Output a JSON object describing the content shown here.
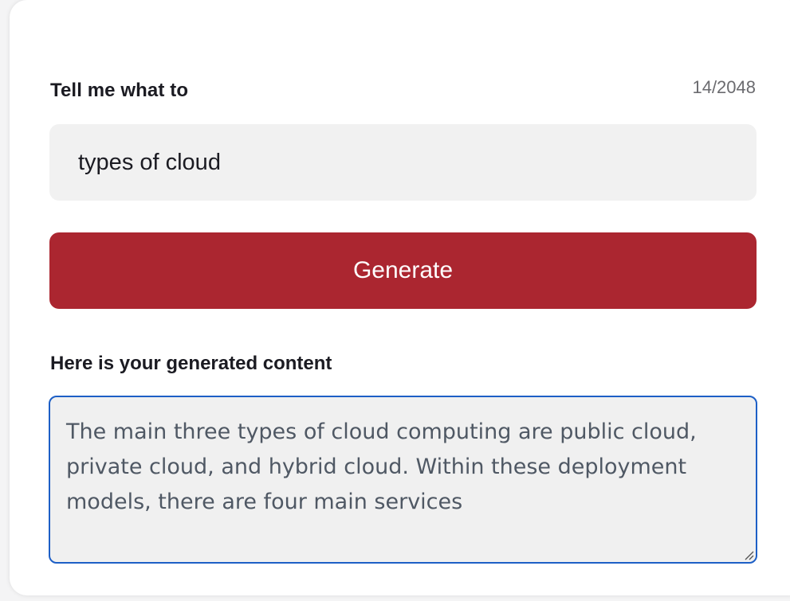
{
  "form": {
    "prompt_label": "Tell me what to",
    "char_count": "14/2048",
    "prompt_value": "types of cloud",
    "generate_label": "Generate",
    "output_label": "Here is your generated content",
    "output_text": "The main three types of cloud computing are public cloud, private cloud, and hybrid cloud. Within these deployment models, there are four main services"
  },
  "colors": {
    "button": "#ab2630",
    "output_border": "#1d5fc6",
    "field_background": "#f1f1f1"
  },
  "icons": {
    "resize_handle": "resize-handle-icon"
  }
}
